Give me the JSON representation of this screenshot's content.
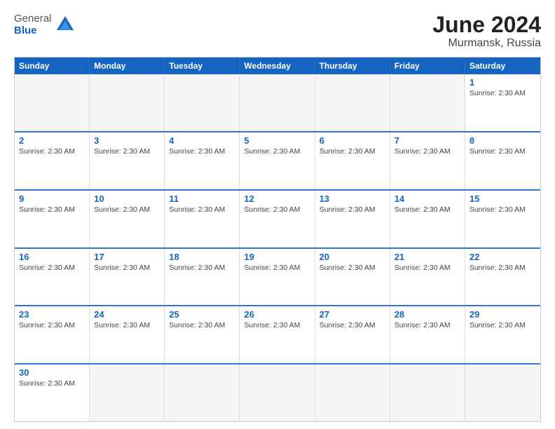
{
  "header": {
    "logo_general": "General",
    "logo_blue": "Blue",
    "cal_title": "June 2024",
    "cal_subtitle": "Murmansk, Russia"
  },
  "weekdays": [
    "Sunday",
    "Monday",
    "Tuesday",
    "Wednesday",
    "Thursday",
    "Friday",
    "Saturday"
  ],
  "sunrise": "Sunrise: 2:30 AM",
  "weeks": [
    [
      {
        "day": "",
        "info": "",
        "empty": true
      },
      {
        "day": "",
        "info": "",
        "empty": true
      },
      {
        "day": "",
        "info": "",
        "empty": true
      },
      {
        "day": "",
        "info": "",
        "empty": true
      },
      {
        "day": "",
        "info": "",
        "empty": true
      },
      {
        "day": "",
        "info": "",
        "empty": true
      },
      {
        "day": "1",
        "info": "Sunrise: 2:30 AM",
        "empty": false
      }
    ],
    [
      {
        "day": "2",
        "info": "Sunrise: 2:30 AM",
        "empty": false
      },
      {
        "day": "3",
        "info": "Sunrise: 2:30 AM",
        "empty": false
      },
      {
        "day": "4",
        "info": "Sunrise: 2:30 AM",
        "empty": false
      },
      {
        "day": "5",
        "info": "Sunrise: 2:30 AM",
        "empty": false
      },
      {
        "day": "6",
        "info": "Sunrise: 2:30 AM",
        "empty": false
      },
      {
        "day": "7",
        "info": "Sunrise: 2:30 AM",
        "empty": false
      },
      {
        "day": "8",
        "info": "Sunrise: 2:30 AM",
        "empty": false
      }
    ],
    [
      {
        "day": "9",
        "info": "Sunrise: 2:30 AM",
        "empty": false
      },
      {
        "day": "10",
        "info": "Sunrise: 2:30 AM",
        "empty": false
      },
      {
        "day": "11",
        "info": "Sunrise: 2:30 AM",
        "empty": false
      },
      {
        "day": "12",
        "info": "Sunrise: 2:30 AM",
        "empty": false
      },
      {
        "day": "13",
        "info": "Sunrise: 2:30 AM",
        "empty": false
      },
      {
        "day": "14",
        "info": "Sunrise: 2:30 AM",
        "empty": false
      },
      {
        "day": "15",
        "info": "Sunrise: 2:30 AM",
        "empty": false
      }
    ],
    [
      {
        "day": "16",
        "info": "Sunrise: 2:30 AM",
        "empty": false
      },
      {
        "day": "17",
        "info": "Sunrise: 2:30 AM",
        "empty": false
      },
      {
        "day": "18",
        "info": "Sunrise: 2:30 AM",
        "empty": false
      },
      {
        "day": "19",
        "info": "Sunrise: 2:30 AM",
        "empty": false
      },
      {
        "day": "20",
        "info": "Sunrise: 2:30 AM",
        "empty": false
      },
      {
        "day": "21",
        "info": "Sunrise: 2:30 AM",
        "empty": false
      },
      {
        "day": "22",
        "info": "Sunrise: 2:30 AM",
        "empty": false
      }
    ],
    [
      {
        "day": "23",
        "info": "Sunrise: 2:30 AM",
        "empty": false
      },
      {
        "day": "24",
        "info": "Sunrise: 2:30 AM",
        "empty": false
      },
      {
        "day": "25",
        "info": "Sunrise: 2:30 AM",
        "empty": false
      },
      {
        "day": "26",
        "info": "Sunrise: 2:30 AM",
        "empty": false
      },
      {
        "day": "27",
        "info": "Sunrise: 2:30 AM",
        "empty": false
      },
      {
        "day": "28",
        "info": "Sunrise: 2:30 AM",
        "empty": false
      },
      {
        "day": "29",
        "info": "Sunrise: 2:30 AM",
        "empty": false
      }
    ],
    [
      {
        "day": "30",
        "info": "Sunrise: 2:30 AM",
        "empty": false
      },
      {
        "day": "",
        "info": "",
        "empty": true
      },
      {
        "day": "",
        "info": "",
        "empty": true
      },
      {
        "day": "",
        "info": "",
        "empty": true
      },
      {
        "day": "",
        "info": "",
        "empty": true
      },
      {
        "day": "",
        "info": "",
        "empty": true
      },
      {
        "day": "",
        "info": "",
        "empty": true
      }
    ]
  ]
}
